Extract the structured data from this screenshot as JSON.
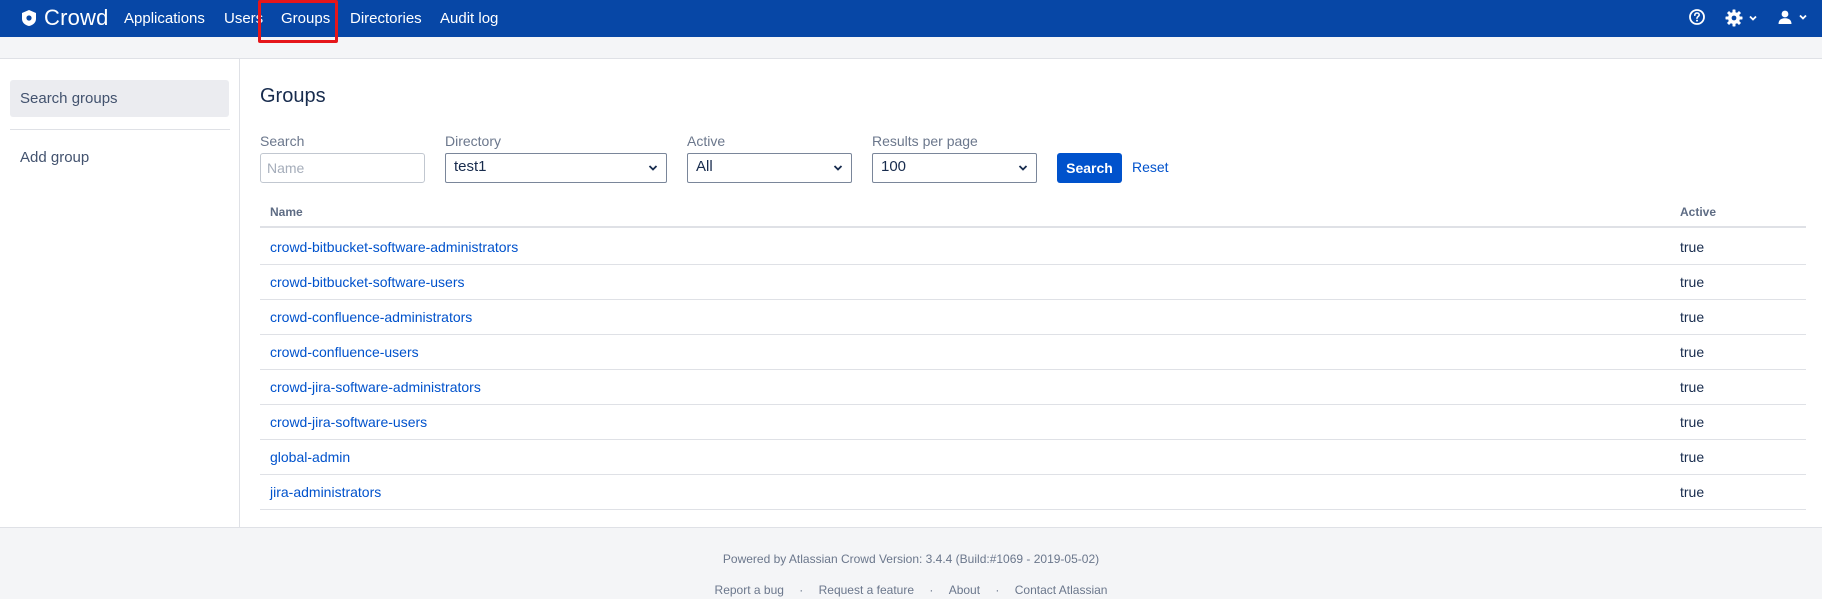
{
  "brand": {
    "name": "Crowd"
  },
  "nav": {
    "items": [
      "Applications",
      "Users",
      "Groups",
      "Directories",
      "Audit log"
    ],
    "right_icons": [
      "help-icon",
      "gear-icon",
      "user-icon"
    ]
  },
  "sidebar": {
    "items": [
      {
        "label": "Search groups",
        "active": true
      },
      {
        "label": "Add group",
        "active": false
      }
    ]
  },
  "page": {
    "title": "Groups"
  },
  "filters": {
    "search_label": "Search",
    "search_placeholder": "Name",
    "search_value": "",
    "directory_label": "Directory",
    "directory_value": "test1",
    "active_label": "Active",
    "active_value": "All",
    "results_label": "Results per page",
    "results_value": "100",
    "search_button": "Search",
    "reset_link": "Reset"
  },
  "table": {
    "columns": [
      "Name",
      "Active"
    ],
    "rows": [
      {
        "name": "crowd-bitbucket-software-administrators",
        "active": "true"
      },
      {
        "name": "crowd-bitbucket-software-users",
        "active": "true"
      },
      {
        "name": "crowd-confluence-administrators",
        "active": "true"
      },
      {
        "name": "crowd-confluence-users",
        "active": "true"
      },
      {
        "name": "crowd-jira-software-administrators",
        "active": "true"
      },
      {
        "name": "crowd-jira-software-users",
        "active": "true"
      },
      {
        "name": "global-admin",
        "active": "true"
      },
      {
        "name": "jira-administrators",
        "active": "true"
      }
    ]
  },
  "footer": {
    "powered_by": "Powered by Atlassian Crowd Version: 3.4.4 (Build:#1069 - 2019-05-02)",
    "links": [
      "Report a bug",
      "Request a feature",
      "About",
      "Contact Atlassian"
    ],
    "separator": "·"
  },
  "colors": {
    "topbar": "#0747a6",
    "link": "#0052cc",
    "highlight": "#e5161a"
  }
}
